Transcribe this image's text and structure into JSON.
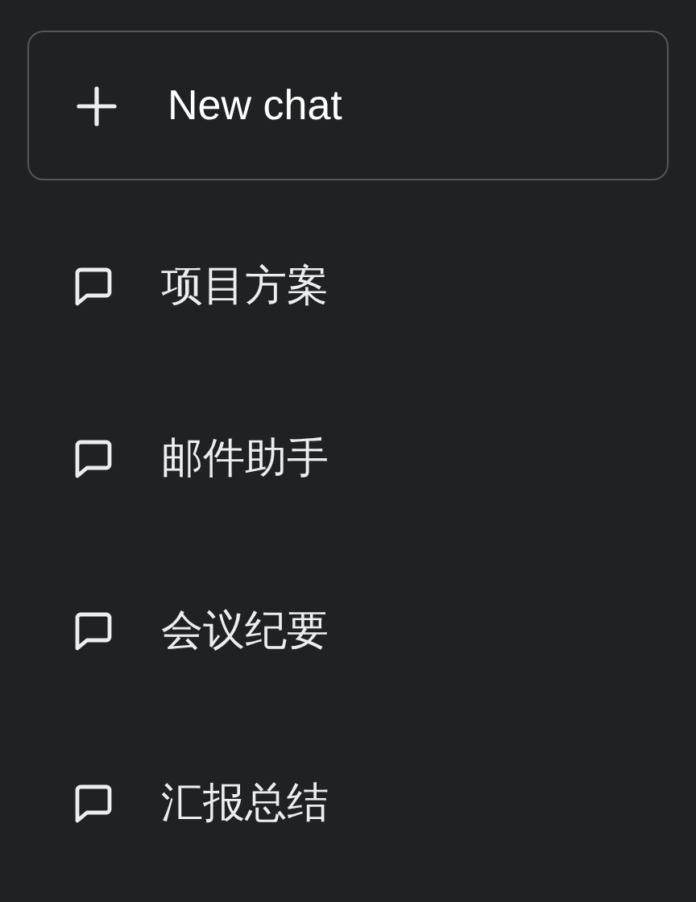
{
  "new_chat_button": {
    "label": "New chat"
  },
  "conversations": [
    {
      "title": "项目方案"
    },
    {
      "title": "邮件助手"
    },
    {
      "title": "会议纪要"
    },
    {
      "title": "汇报总结"
    }
  ]
}
